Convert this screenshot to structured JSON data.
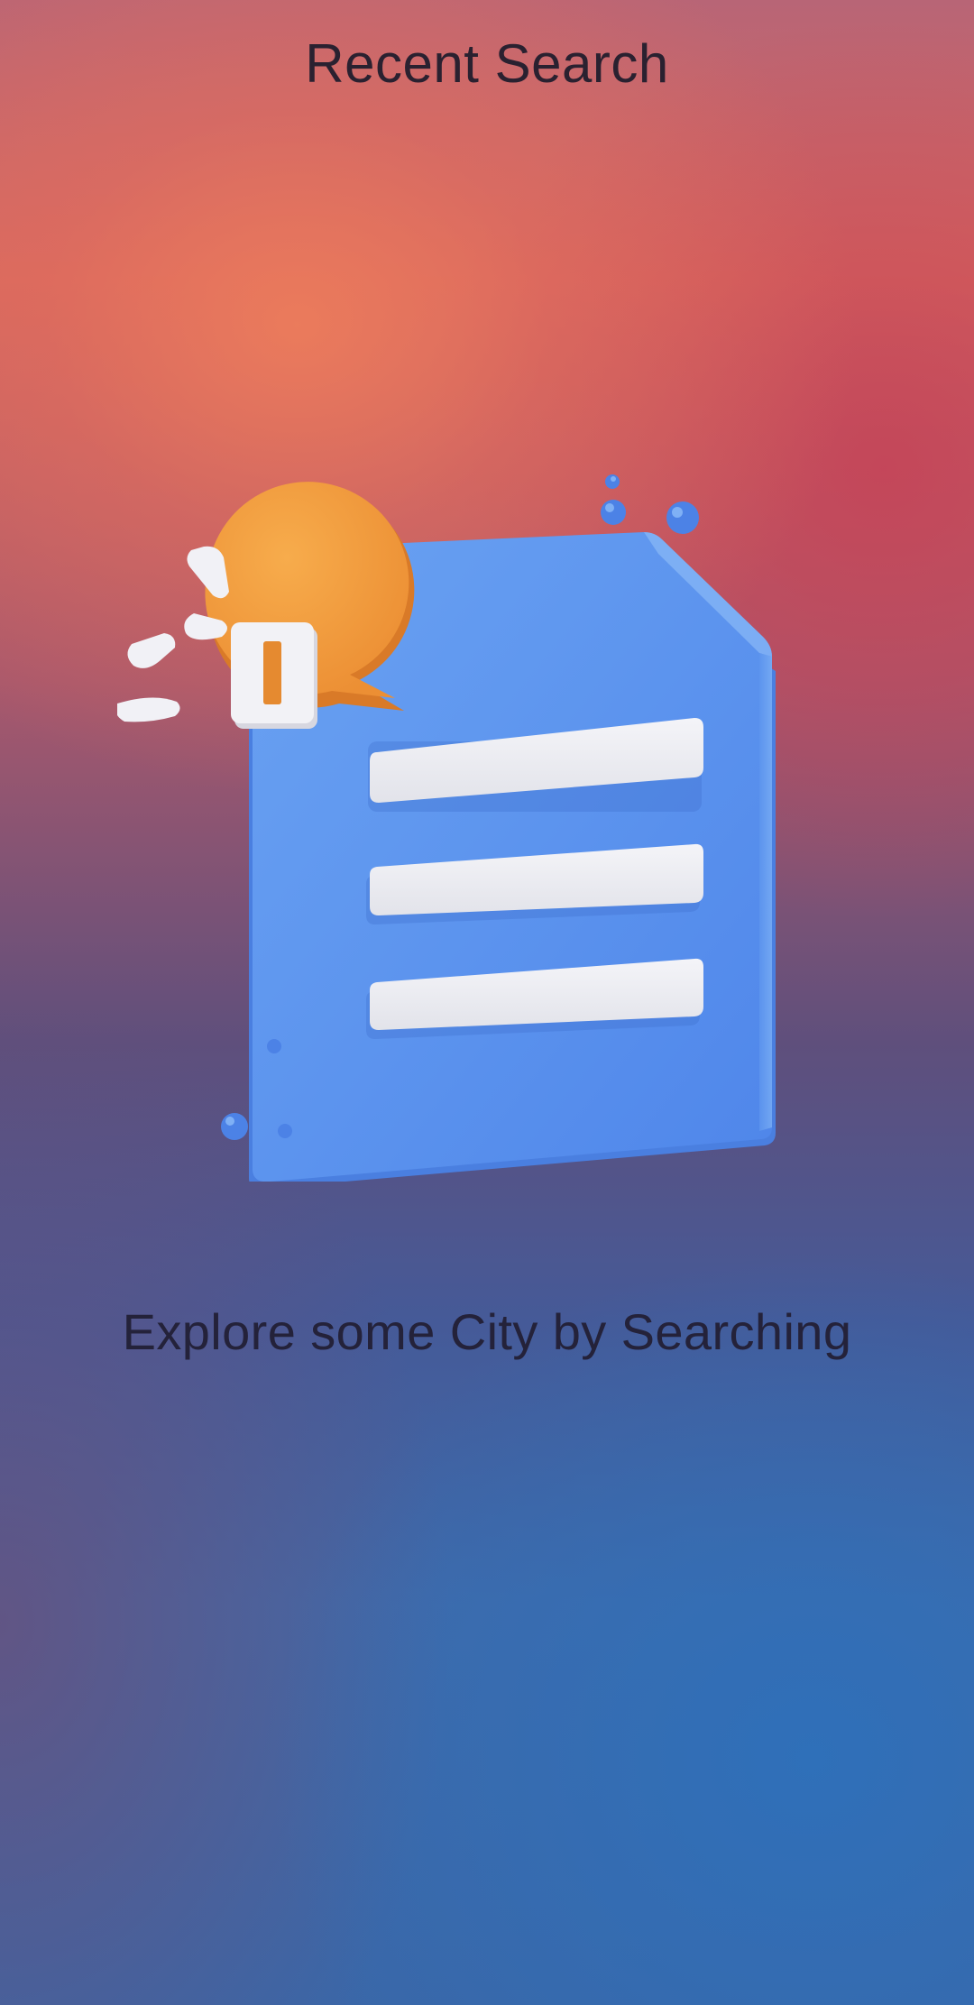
{
  "header": {
    "title": "Recent Search"
  },
  "empty_state": {
    "illustration_icon": "document-with-notification-bubble-icon",
    "message": "Explore some City by Searching"
  },
  "colors": {
    "document_blue": "#5b93ee",
    "bubble_orange": "#f29a3c",
    "text_dark": "#2a2130"
  }
}
